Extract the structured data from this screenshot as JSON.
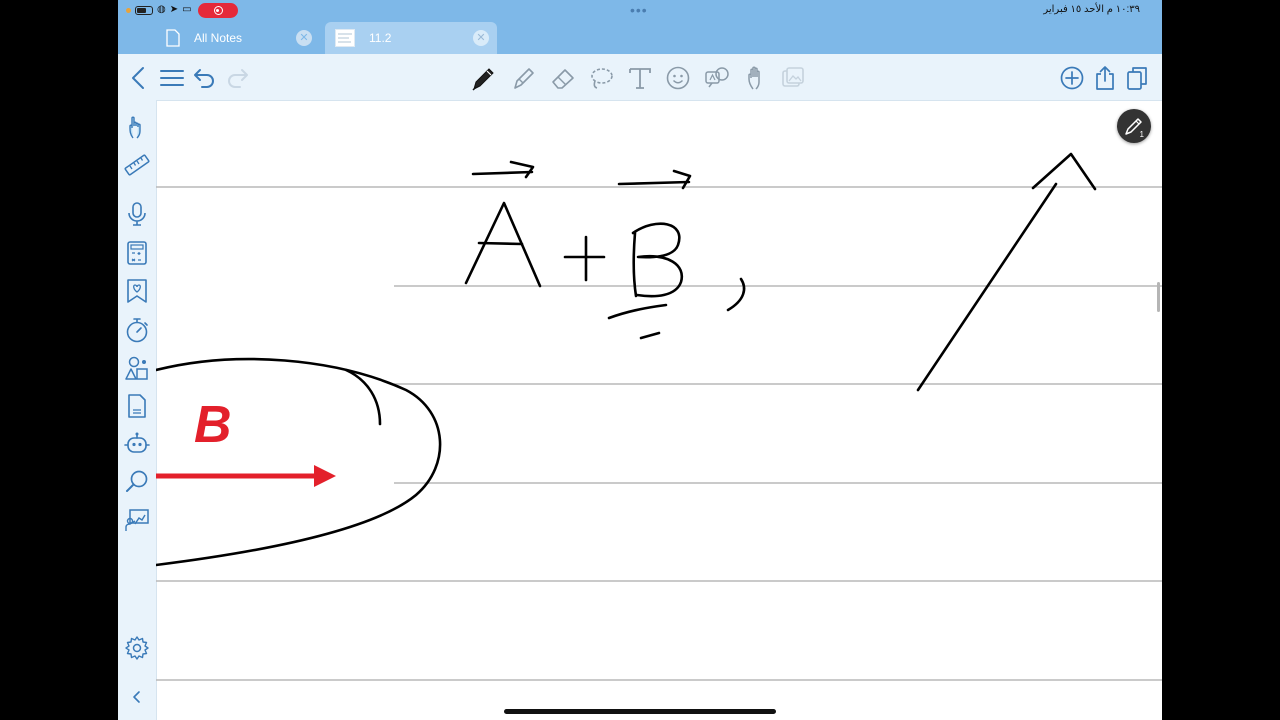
{
  "status_bar": {
    "clock": "١٠:٣٩ م  الأحد ١٥ فبراير",
    "center_dots": "•••",
    "indicators": [
      "battery-icon",
      "wifi-icon",
      "location-icon",
      "screen-record-icon"
    ]
  },
  "tabs": [
    {
      "label": "All Notes",
      "icon": "document-icon",
      "active": false
    },
    {
      "label": "11.2",
      "icon": "notebook-thumbnail-icon",
      "active": true
    }
  ],
  "toolbar": {
    "left": [
      "back-icon",
      "menu-icon",
      "undo-icon",
      "redo-icon"
    ],
    "tools": [
      "pen-icon",
      "highlighter-icon",
      "eraser-icon",
      "lasso-icon",
      "text-icon",
      "sticker-icon",
      "translate-icon",
      "hand-icon",
      "image-icon"
    ],
    "right": [
      "add-page-icon",
      "share-icon",
      "pages-icon"
    ],
    "selected_tool": "pen"
  },
  "sidebar": {
    "items": [
      "pointer-hand-icon",
      "ruler-icon",
      "microphone-icon",
      "calculator-icon",
      "bookmark-icon",
      "timer-icon",
      "shapes-icon",
      "document-icon",
      "ai-assistant-icon",
      "search-icon",
      "presentation-icon"
    ],
    "bottom": [
      "settings-icon",
      "collapse-icon"
    ]
  },
  "canvas": {
    "red_letter": "B",
    "colors": {
      "ink": "#000000",
      "red_vector": "#e3202b",
      "rule_line": "#b8b8b8"
    },
    "ruled": true
  },
  "pen_badge": {
    "count": "1"
  }
}
